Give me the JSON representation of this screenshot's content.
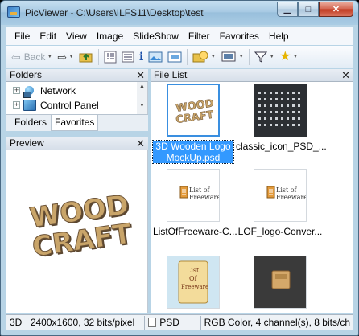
{
  "window": {
    "title": "PicViewer - C:\\Users\\ILFS11\\Desktop\\test"
  },
  "menu": [
    "File",
    "Edit",
    "View",
    "Image",
    "SlideShow",
    "Filter",
    "Favorites",
    "Help"
  ],
  "toolbar": {
    "back_label": "Back"
  },
  "folders_pane": {
    "title": "Folders",
    "items": [
      {
        "label": "Network"
      },
      {
        "label": "Control Panel"
      }
    ],
    "tabs": [
      "Folders",
      "Favorites"
    ]
  },
  "preview_pane": {
    "title": "Preview",
    "image_text_line1": "WOOD",
    "image_text_line2": "CRAFT"
  },
  "filelist_pane": {
    "title": "File List",
    "files": [
      {
        "label": "3D Wooden Logo MockUp.psd",
        "selected": true,
        "thumb": "wood-craft"
      },
      {
        "label": "classic_icon_PSD_...",
        "selected": false,
        "thumb": "icon-grid"
      },
      {
        "label": "ListOfFreeware-C...",
        "selected": false,
        "thumb": "listoffreeware"
      },
      {
        "label": "LOF_logo-Conver...",
        "selected": false,
        "thumb": "listoffreeware"
      },
      {
        "label": "",
        "selected": false,
        "thumb": "scroll-paper"
      },
      {
        "label": "",
        "selected": false,
        "thumb": "dark-box"
      }
    ],
    "thumb_text": {
      "wood": "WOOD",
      "craft": "CRAFT",
      "list_of": "List of",
      "freeware": "Freeware",
      "scroll_1": "List",
      "scroll_2": "Of",
      "scroll_3": "Freeware"
    }
  },
  "status": {
    "mode": "3D",
    "dimensions": "2400x1600, 32 bits/pixel",
    "format": "PSD",
    "color_info": "RGB Color, 4 channel(s), 8 bits/ch"
  },
  "colors": {
    "selection": "#3399ff",
    "title_gradient": "#a9cbe4",
    "wood": "#c9a56a"
  }
}
